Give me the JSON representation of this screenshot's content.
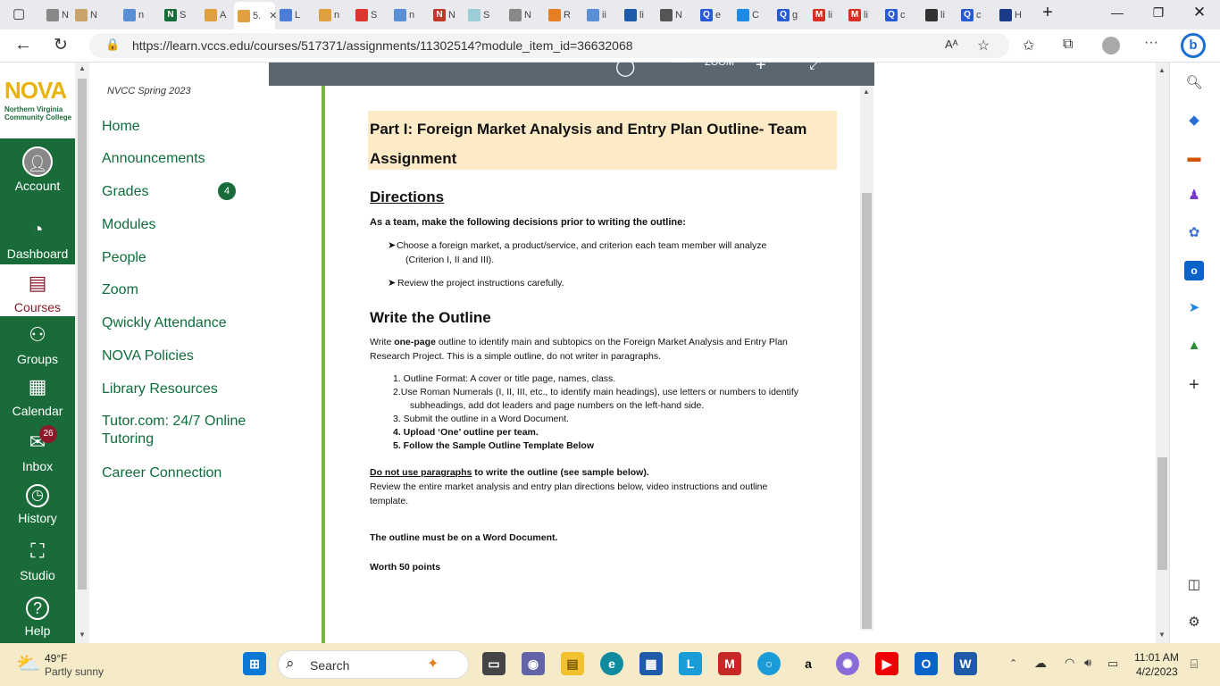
{
  "browser": {
    "tabs": [
      {
        "favicon_color": "#888",
        "label": "N"
      },
      {
        "favicon_color": "#c9a36a",
        "label": "N"
      },
      {
        "favicon_color": "#5a8fd6",
        "label": "n"
      },
      {
        "favicon_color": "#1a6b3a",
        "favicon_text": "N",
        "label": "S"
      },
      {
        "favicon_color": "#e0a040",
        "label": "A"
      },
      {
        "favicon_color": "#e0a040",
        "label": "5.",
        "active": true
      },
      {
        "favicon_color": "#4c7bd9",
        "label": "L"
      },
      {
        "favicon_color": "#e0a040",
        "label": "n"
      },
      {
        "favicon_color": "#e0342f",
        "label": "S"
      },
      {
        "favicon_color": "#5a8fd6",
        "label": "n"
      },
      {
        "favicon_color": "#c0392b",
        "favicon_text": "N",
        "label": "N"
      },
      {
        "favicon_color": "#9ccdd6",
        "label": "S"
      },
      {
        "favicon_color": "#888",
        "label": "N"
      },
      {
        "favicon_color": "#e67e22",
        "label": "R"
      },
      {
        "favicon_color": "#5a8fd6",
        "label": "ii"
      },
      {
        "favicon_color": "#1e5aa8",
        "label": "li"
      },
      {
        "favicon_color": "#555",
        "label": "N"
      },
      {
        "favicon_color": "#2a5bd7",
        "favicon_text": "Q",
        "label": "e"
      },
      {
        "favicon_color": "#1e88e5",
        "label": "C"
      },
      {
        "favicon_color": "#2a5bd7",
        "favicon_text": "Q",
        "label": "g"
      },
      {
        "favicon_color": "#d93025",
        "favicon_text": "M",
        "label": "li"
      },
      {
        "favicon_color": "#d93025",
        "favicon_text": "M",
        "label": "li"
      },
      {
        "favicon_color": "#2a5bd7",
        "favicon_text": "Q",
        "label": "c"
      },
      {
        "favicon_color": "#333",
        "label": "li"
      },
      {
        "favicon_color": "#2a5bd7",
        "favicon_text": "Q",
        "label": "c"
      },
      {
        "favicon_color": "#1a3a8a",
        "label": "H"
      }
    ],
    "url": "https://learn.vccs.edu/courses/517371/assignments/11302514?module_item_id=36632068"
  },
  "global_nav": {
    "logo_big": "NOVA",
    "logo_small_1": "Northern Virginia",
    "logo_small_2": "Community College",
    "items": [
      {
        "label": "Account",
        "icon": "account-icon"
      },
      {
        "label": "Dashboard",
        "icon": "dashboard-icon"
      },
      {
        "label": "Courses",
        "icon": "courses-icon"
      },
      {
        "label": "Groups",
        "icon": "groups-icon"
      },
      {
        "label": "Calendar",
        "icon": "calendar-icon"
      },
      {
        "label": "Inbox",
        "icon": "inbox-icon",
        "badge": "26"
      },
      {
        "label": "History",
        "icon": "history-icon"
      },
      {
        "label": "Studio",
        "icon": "studio-icon"
      },
      {
        "label": "Help",
        "icon": "help-icon"
      }
    ]
  },
  "course_nav": {
    "term": "NVCC Spring 2023",
    "links": [
      "Home",
      "Announcements",
      "Grades",
      "Modules",
      "People",
      "Zoom",
      "Qwickly Attendance",
      "NOVA Policies",
      "Library Resources",
      "Tutor.com: 24/7 Online Tutoring",
      "Career Connection"
    ],
    "grades_badge": "4"
  },
  "viewer": {
    "zoom_label": "ZOOM"
  },
  "document": {
    "heading": "Part I: Foreign Market Analysis and Entry Plan Outline- Team Assignment",
    "directions_title": "Directions",
    "directions_intro": "As a team, make the following decisions prior to writing the outline:",
    "bullet1": "Choose a foreign market, a product/service, and criterion each team member will analyze",
    "bullet1b": "(Criterion I, II and III).",
    "bullet2": "Review the project instructions carefully.",
    "write_title": "Write the Outline",
    "write_p1_pre": "Write ",
    "write_p1_bold": "one-page",
    "write_p1_post": " outline to identify main and subtopics on the Foreign Market Analysis and Entry Plan",
    "write_p1_line2": "Research Project.  This is a simple outline, do not writer in paragraphs.",
    "list1": "1. Outline Format: A cover or title page, names, class.",
    "list2": "2.Use Roman Numerals (I, II, III, etc., to identify main headings), use letters or numbers to identify",
    "list2b": "subheadings, add dot leaders and page numbers on the left-hand side.",
    "list3": "3. Submit the outline in a Word Document.",
    "list4": "4. Upload ‘One’ outline per team.",
    "list5": "5. Follow the Sample Outline Template Below",
    "para_u": "Do not use paragraphs",
    "para_rest": " to write the outline (see sample below).",
    "review1": "Review the entire market analysis and entry plan directions below, video instructions and outline",
    "review2": "template.",
    "word_doc": "The outline must be on a Word Document.",
    "worth": "Worth 50 points"
  },
  "taskbar": {
    "weather_temp": "49°F",
    "weather_desc": "Partly sunny",
    "search_placeholder": "Search",
    "time": "11:01 AM",
    "date": "4/2/2023"
  },
  "colors": {
    "nav_green": "#1a6b3a",
    "courses_active": "#8b1a2b",
    "highlight": "#fdebc8",
    "link_green": "#0d6e3b"
  }
}
